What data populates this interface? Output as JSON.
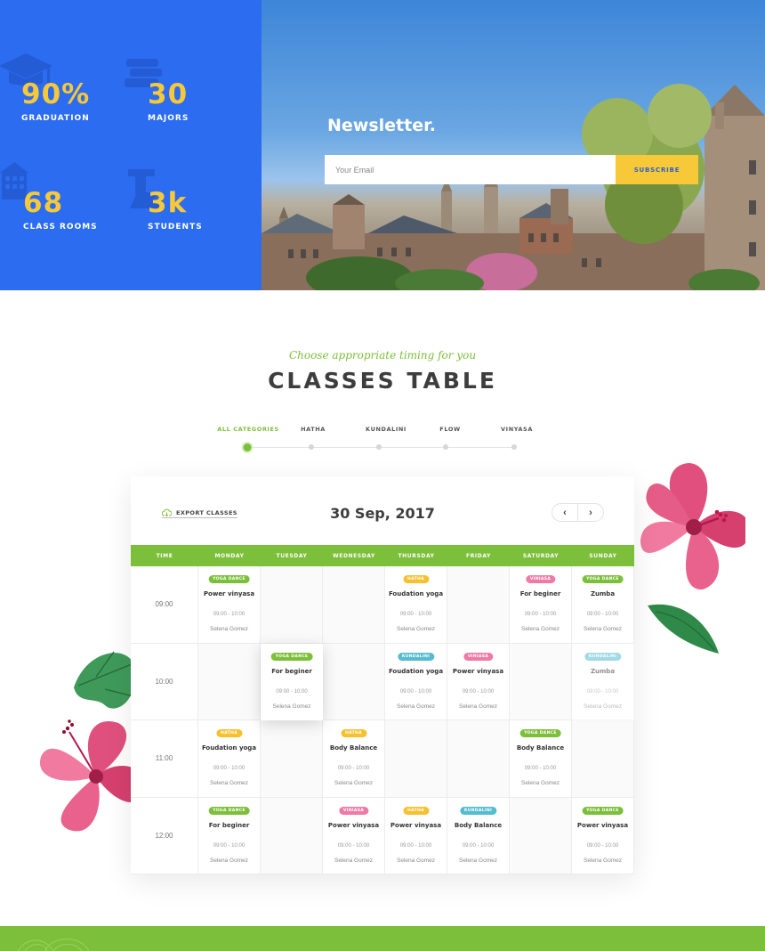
{
  "stats": [
    {
      "value": "90%",
      "label": "GRADUATION",
      "icon": "graduation-cap-icon"
    },
    {
      "value": "30",
      "label": "MAJORS",
      "icon": "books-icon"
    },
    {
      "value": "68",
      "label": "CLASS ROOMS",
      "icon": "building-icon"
    },
    {
      "value": "3k",
      "label": "STUDENTS",
      "icon": "student-icon"
    }
  ],
  "newsletter": {
    "title": "Newsletter.",
    "placeholder": "Your Email",
    "button": "SUBSCRIBE"
  },
  "section": {
    "subtitle": "Choose appropriate timing for you",
    "title": "CLASSES TABLE"
  },
  "categories": [
    {
      "label": "ALL CATEGORIES",
      "active": true
    },
    {
      "label": "HATHA",
      "active": false
    },
    {
      "label": "KUNDALINI",
      "active": false
    },
    {
      "label": "FLOW",
      "active": false
    },
    {
      "label": "VINYASA",
      "active": false
    }
  ],
  "table": {
    "export_label": "EXPORT CLASSES",
    "date": "30 Sep, 2017",
    "prev": "‹",
    "next": "›",
    "columns": [
      "TIME",
      "MONDAY",
      "TUESDAY",
      "WEDNESDAY",
      "THURSDAY",
      "FRIDAY",
      "SATURDAY",
      "SUNDAY"
    ],
    "rows": [
      {
        "time": "09:00",
        "cells": [
          {
            "tag": "YOGA DANCE",
            "name": "Power vinyasa",
            "hours": "09:00 - 10:00",
            "teacher": "Selena Gomez"
          },
          null,
          null,
          {
            "tag": "HATHA",
            "name": "Foudation yoga",
            "hours": "09:00 - 10:00",
            "teacher": "Selena Gomez"
          },
          null,
          {
            "tag": "VINIASA",
            "name": "For beginer",
            "hours": "09:00 - 10:00",
            "teacher": "Selena Gomez"
          },
          {
            "tag": "YOGA DANCE",
            "name": "Zumba",
            "hours": "09:00 - 10:00",
            "teacher": "Selena Gomez"
          }
        ]
      },
      {
        "time": "10:00",
        "cells": [
          null,
          {
            "tag": "YOGA DANCE",
            "name": "For beginer",
            "hours": "09:00 - 10:00",
            "teacher": "Selena Gomez",
            "raised": true
          },
          null,
          {
            "tag": "KUNDALINI",
            "name": "Foudation yoga",
            "hours": "09:00 - 10:00",
            "teacher": "Selena Gomez"
          },
          {
            "tag": "VINIASA",
            "name": "Power vinyasa",
            "hours": "09:00 - 10:00",
            "teacher": "Selena Gomez"
          },
          null,
          {
            "tag": "KUNDALINI",
            "name": "Zumba",
            "hours": "09:00 - 10:00",
            "teacher": "Selena Gomez",
            "faded": true
          }
        ]
      },
      {
        "time": "11:00",
        "cells": [
          {
            "tag": "HATHA",
            "name": "Foudation yoga",
            "hours": "09:00 - 10:00",
            "teacher": "Selena Gomez"
          },
          null,
          {
            "tag": "HATHA",
            "name": "Body Balance",
            "hours": "09:00 - 10:00",
            "teacher": "Selena Gomez"
          },
          null,
          null,
          {
            "tag": "YOGA DANCE",
            "name": "Body Balance",
            "hours": "09:00 - 10:00",
            "teacher": "Selena Gomez"
          },
          null
        ]
      },
      {
        "time": "12:00",
        "cells": [
          {
            "tag": "YOGA DANCE",
            "name": "For beginer",
            "hours": "09:00 - 10:00",
            "teacher": "Selena Gomez"
          },
          null,
          {
            "tag": "VINIASA",
            "name": "Power vinyasa",
            "hours": "09:00 - 10:00",
            "teacher": "Selena Gomez"
          },
          {
            "tag": "HATHA",
            "name": "Power vinyasa",
            "hours": "09:00 - 10:00",
            "teacher": "Selena Gomez"
          },
          {
            "tag": "KUNDALINI",
            "name": "Body Balance",
            "hours": "09:00 - 10:00",
            "teacher": "Selena Gomez"
          },
          null,
          {
            "tag": "YOGA DANCE",
            "name": "Power vinyasa",
            "hours": "09:00 - 10:00",
            "teacher": "Selena Gomez"
          }
        ]
      }
    ]
  },
  "tag_colors": {
    "YOGA DANCE": "#7cbf3a",
    "HATHA": "#f7c02e",
    "VINIASA": "#f07aa6",
    "KUNDALINI": "#55bcd0"
  },
  "colors": {
    "primary_blue": "#2b6cf0",
    "accent_yellow": "#f7c837",
    "accent_green": "#7cbf3a"
  }
}
